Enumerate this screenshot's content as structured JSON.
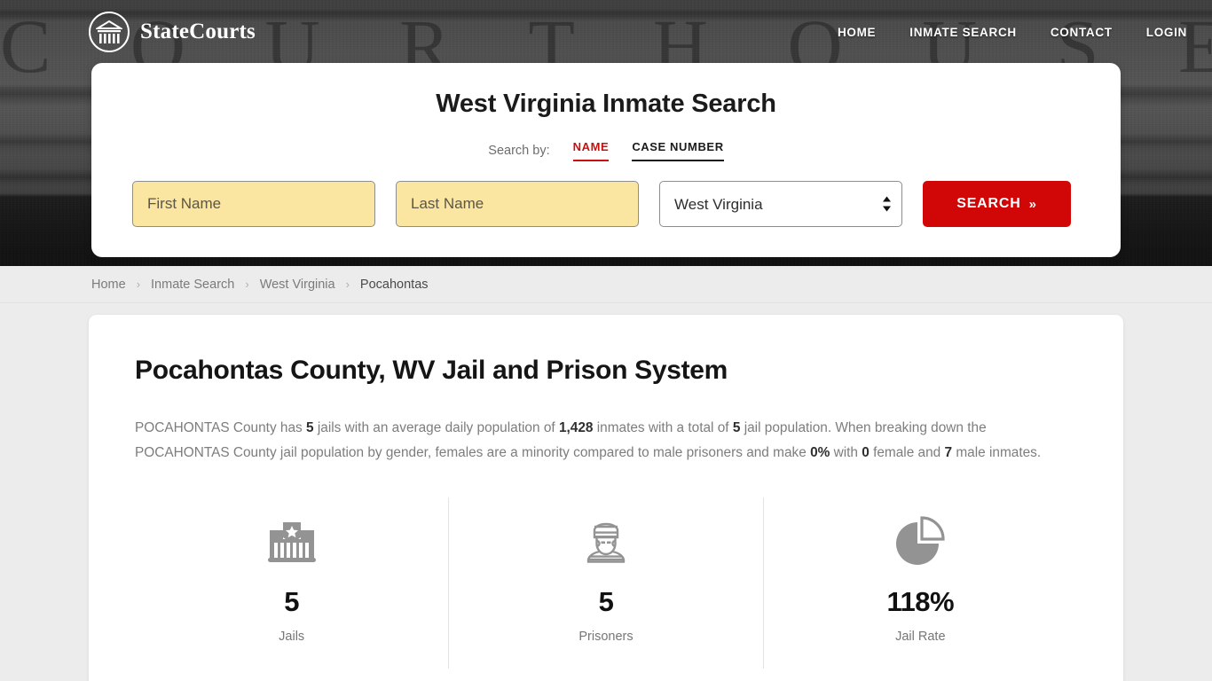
{
  "header": {
    "brand_name": "StateCourts",
    "brand_icon": "courthouse-logo-icon",
    "backdrop_text": "C O U R T   H O U S E",
    "nav": [
      {
        "label": "HOME",
        "name": "nav-home"
      },
      {
        "label": "INMATE SEARCH",
        "name": "nav-inmate-search"
      },
      {
        "label": "CONTACT",
        "name": "nav-contact"
      },
      {
        "label": "LOGIN",
        "name": "nav-login"
      }
    ]
  },
  "search": {
    "title": "West Virginia Inmate Search",
    "search_by_label": "Search by:",
    "tabs": [
      {
        "label": "NAME",
        "active": true
      },
      {
        "label": "CASE NUMBER",
        "active": false
      }
    ],
    "first_name_placeholder": "First Name",
    "first_name_value": "",
    "last_name_placeholder": "Last Name",
    "last_name_value": "",
    "state_selected": "West Virginia",
    "state_options": [
      "West Virginia"
    ],
    "submit_label": "SEARCH",
    "submit_chevron": "»",
    "accent_color": "#d10606",
    "field_fill_color": "#fae6a0"
  },
  "breadcrumb": {
    "separator": "›",
    "items": [
      {
        "label": "Home",
        "current": false
      },
      {
        "label": "Inmate Search",
        "current": false
      },
      {
        "label": "West Virginia",
        "current": false
      },
      {
        "label": "Pocahontas",
        "current": true
      }
    ]
  },
  "main": {
    "page_title": "Pocahontas County, WV Jail and Prison System",
    "summary": {
      "p1": "POCAHONTAS County has ",
      "b1": "5",
      "p2": " jails with an average daily population of ",
      "b2": "1,428",
      "p3": " inmates with a total of ",
      "b3": "5",
      "p4": " jail population. When breaking down the POCAHONTAS County jail population by gender, females are a minority compared to male prisoners and make ",
      "b4": "0%",
      "p5": " with ",
      "b5": "0",
      "p6": " female and ",
      "b6": "7",
      "p7": " male inmates."
    },
    "stats": [
      {
        "icon": "jail-building-icon",
        "value": "5",
        "label": "Jails"
      },
      {
        "icon": "prisoner-icon",
        "value": "5",
        "label": "Prisoners"
      },
      {
        "icon": "pie-chart-icon",
        "value": "118%",
        "label": "Jail Rate"
      }
    ]
  }
}
